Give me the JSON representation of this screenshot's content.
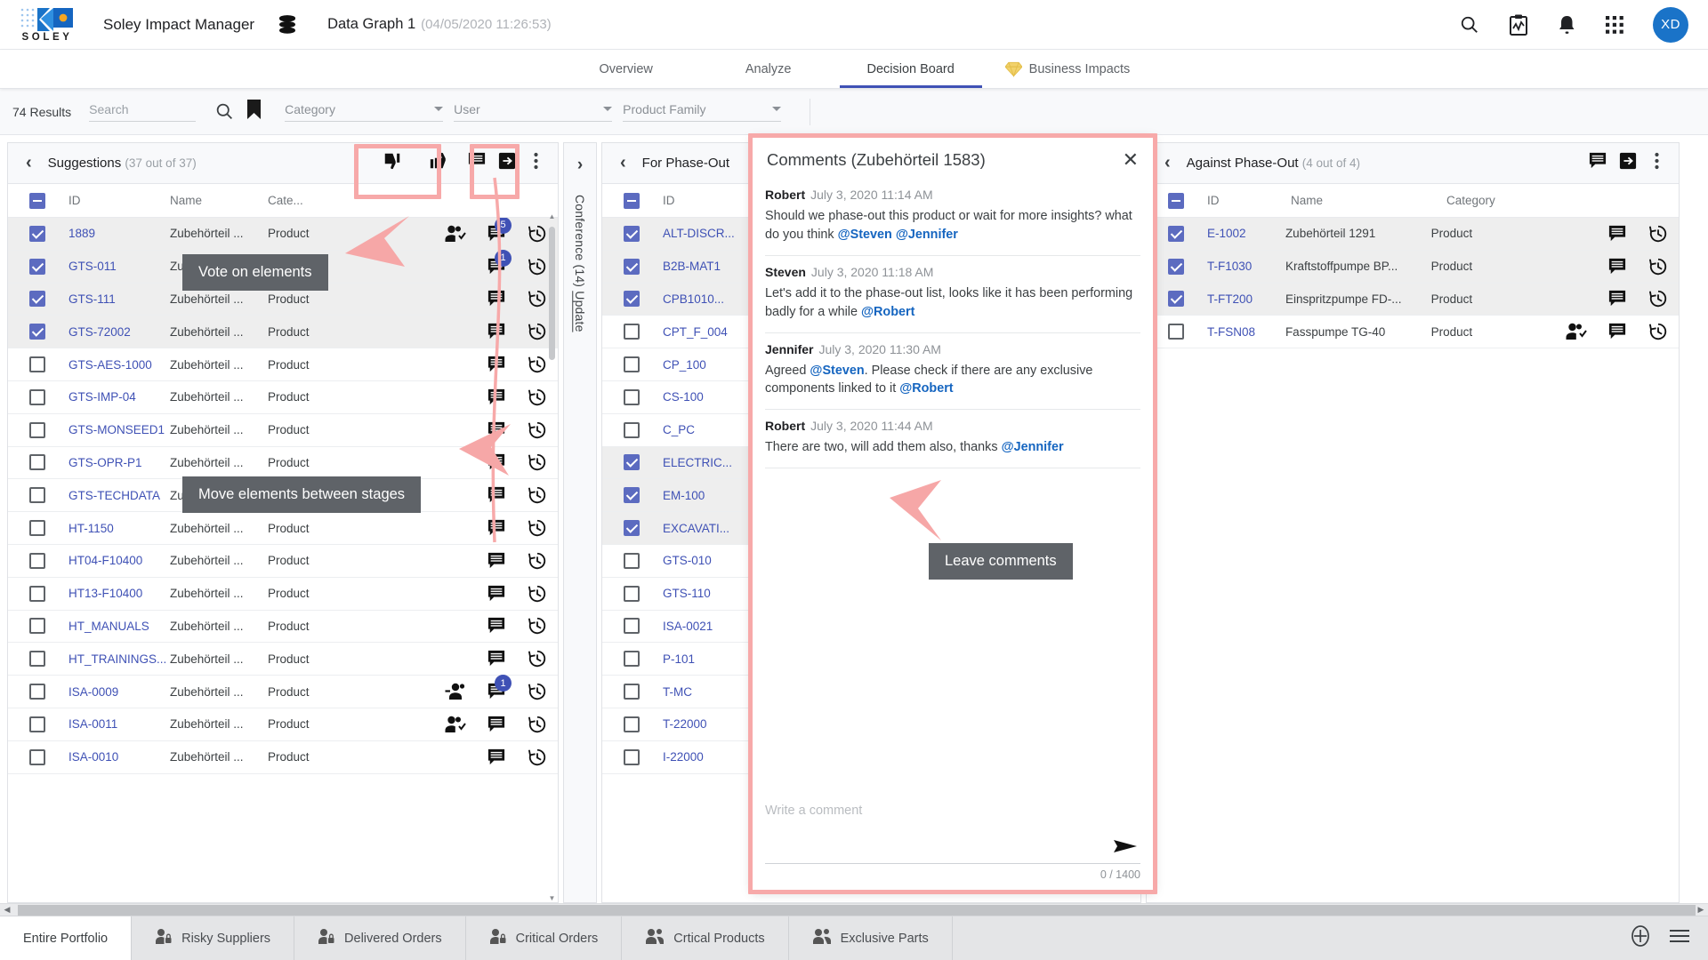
{
  "app": {
    "brand": "SOLEY",
    "title": "Soley Impact Manager",
    "graph_name": "Data Graph 1",
    "graph_date": "(04/05/2020 11:26:53)",
    "avatar_initials": "XD",
    "accent_color": "#3f51b5",
    "highlight_color": "#f7a9a9"
  },
  "topbar_icons": [
    {
      "name": "search-icon"
    },
    {
      "name": "report-icon"
    },
    {
      "name": "notifications-icon"
    },
    {
      "name": "apps-grid-icon"
    }
  ],
  "nav": {
    "tabs": [
      {
        "label": "Overview",
        "active": false,
        "icon": ""
      },
      {
        "label": "Analyze",
        "active": false,
        "icon": ""
      },
      {
        "label": "Decision Board",
        "active": true,
        "icon": ""
      },
      {
        "label": "Business Impacts",
        "active": false,
        "icon": "diamond-icon"
      }
    ]
  },
  "filterbar": {
    "results": "74 Results",
    "search_placeholder": "Search",
    "selects": [
      {
        "label": "Category"
      },
      {
        "label": "User"
      },
      {
        "label": "Product Family"
      }
    ]
  },
  "panels": {
    "suggestions": {
      "title": "Suggestions",
      "count": "(37 out of 37)",
      "columns": [
        "ID",
        "Name",
        "Cate..."
      ],
      "rows": [
        {
          "id": "1889",
          "name": "Zubehörteil ...",
          "cat": "Product",
          "sel": true,
          "users": "users-check-icon",
          "comments": "5"
        },
        {
          "id": "GTS-011",
          "name": "Zubehörteil ...",
          "cat": "Product",
          "sel": true,
          "users": "",
          "comments": "1"
        },
        {
          "id": "GTS-111",
          "name": "Zubehörteil ...",
          "cat": "Product",
          "sel": true,
          "users": "",
          "comments": ""
        },
        {
          "id": "GTS-72002",
          "name": "Zubehörteil ...",
          "cat": "Product",
          "sel": true,
          "users": "",
          "comments": ""
        },
        {
          "id": "GTS-AES-1000",
          "name": "Zubehörteil ...",
          "cat": "Product",
          "sel": false,
          "users": "",
          "comments": ""
        },
        {
          "id": "GTS-IMP-04",
          "name": "Zubehörteil ...",
          "cat": "Product",
          "sel": false,
          "users": "",
          "comments": ""
        },
        {
          "id": "GTS-MONSEED1",
          "name": "Zubehörteil ...",
          "cat": "Product",
          "sel": false,
          "users": "",
          "comments": ""
        },
        {
          "id": "GTS-OPR-P1",
          "name": "Zubehörteil ...",
          "cat": "Product",
          "sel": false,
          "users": "",
          "comments": ""
        },
        {
          "id": "GTS-TECHDATA",
          "name": "Zubehörteil ...",
          "cat": "Product",
          "sel": false,
          "users": "",
          "comments": ""
        },
        {
          "id": "HT-1150",
          "name": "Zubehörteil ...",
          "cat": "Product",
          "sel": false,
          "users": "",
          "comments": ""
        },
        {
          "id": "HT04-F10400",
          "name": "Zubehörteil ...",
          "cat": "Product",
          "sel": false,
          "users": "",
          "comments": ""
        },
        {
          "id": "HT13-F10400",
          "name": "Zubehörteil ...",
          "cat": "Product",
          "sel": false,
          "users": "",
          "comments": ""
        },
        {
          "id": "HT_MANUALS",
          "name": "Zubehörteil ...",
          "cat": "Product",
          "sel": false,
          "users": "",
          "comments": ""
        },
        {
          "id": "HT_TRAININGS...",
          "name": "Zubehörteil ...",
          "cat": "Product",
          "sel": false,
          "users": "",
          "comments": ""
        },
        {
          "id": "ISA-0009",
          "name": "Zubehörteil ...",
          "cat": "Product",
          "sel": false,
          "users": "users-minus-icon",
          "comments": "1"
        },
        {
          "id": "ISA-0011",
          "name": "Zubehörteil ...",
          "cat": "Product",
          "sel": false,
          "users": "users-check-icon",
          "comments": ""
        },
        {
          "id": "ISA-0010",
          "name": "Zubehörteil ...",
          "cat": "Product",
          "sel": false,
          "users": "",
          "comments": ""
        }
      ]
    },
    "conference": {
      "label": "Conference (14)",
      "update_link": "Update"
    },
    "for_phase_out": {
      "title": "For Phase-Out",
      "columns": [
        "ID"
      ],
      "rows": [
        {
          "id": "ALT-DISCR...",
          "sel": true
        },
        {
          "id": "B2B-MAT1",
          "sel": true
        },
        {
          "id": "CPB1010...",
          "sel": true
        },
        {
          "id": "CPT_F_004",
          "sel": false
        },
        {
          "id": "CP_100",
          "sel": false
        },
        {
          "id": "CS-100",
          "sel": false
        },
        {
          "id": "C_PC",
          "sel": false
        },
        {
          "id": "ELECTRIC...",
          "sel": true
        },
        {
          "id": "EM-100",
          "sel": true
        },
        {
          "id": "EXCAVATI...",
          "sel": true
        },
        {
          "id": "GTS-010",
          "sel": false
        },
        {
          "id": "GTS-110",
          "sel": false
        },
        {
          "id": "ISA-0021",
          "sel": false
        },
        {
          "id": "P-101",
          "sel": false
        },
        {
          "id": "T-MC",
          "sel": false
        },
        {
          "id": "T-22000",
          "sel": false
        },
        {
          "id": "I-22000",
          "sel": false
        }
      ]
    },
    "against_phase_out": {
      "title": "Against Phase-Out",
      "count": "(4 out of 4)",
      "columns": [
        "ID",
        "Name",
        "Category"
      ],
      "rows": [
        {
          "id": "E-1002",
          "name": "Zubehörteil 1291",
          "cat": "Product",
          "sel": true,
          "users": ""
        },
        {
          "id": "T-F1030",
          "name": "Kraftstoffpumpe BP...",
          "cat": "Product",
          "sel": true,
          "users": ""
        },
        {
          "id": "T-FT200",
          "name": "Einspritzpumpe FD-...",
          "cat": "Product",
          "sel": true,
          "users": ""
        },
        {
          "id": "T-FSN08",
          "name": "Fasspumpe TG-40",
          "cat": "Product",
          "sel": false,
          "users": "users-check-icon"
        }
      ]
    }
  },
  "comments": {
    "title": "Comments (Zubehörteil 1583)",
    "items": [
      {
        "author": "Robert",
        "time": "July 3, 2020 11:14 AM",
        "parts": [
          {
            "t": "Should we phase-out this product or wait for more insights? what do you think ",
            "m": false
          },
          {
            "t": "@Steven",
            "m": true
          },
          {
            "t": " ",
            "m": false
          },
          {
            "t": "@Jennifer",
            "m": true
          }
        ]
      },
      {
        "author": "Steven",
        "time": "July 3, 2020 11:18 AM",
        "parts": [
          {
            "t": "Let's add it to the phase-out list, looks like it has been performing badly for a while ",
            "m": false
          },
          {
            "t": "@Robert",
            "m": true
          }
        ]
      },
      {
        "author": "Jennifer",
        "time": "July 3, 2020 11:30 AM",
        "parts": [
          {
            "t": "Agreed ",
            "m": false
          },
          {
            "t": "@Steven",
            "m": true
          },
          {
            "t": ". Please check if there are any exclusive components linked to it ",
            "m": false
          },
          {
            "t": "@Robert",
            "m": true
          }
        ]
      },
      {
        "author": "Robert",
        "time": "July 3, 2020 11:44 AM",
        "parts": [
          {
            "t": "There are two, will add them also, thanks ",
            "m": false
          },
          {
            "t": "@Jennifer",
            "m": true
          }
        ]
      }
    ],
    "compose_placeholder": "Write a comment",
    "counter": "0 / 1400"
  },
  "annotations": [
    {
      "text": "Vote on elements"
    },
    {
      "text": "Move elements between stages"
    },
    {
      "text": "Leave comments"
    }
  ],
  "bottom": {
    "tabs": [
      {
        "label": "Entire Portfolio",
        "active": true,
        "icon": ""
      },
      {
        "label": "Risky Suppliers",
        "active": false,
        "icon": "user-lock-icon"
      },
      {
        "label": "Delivered Orders",
        "active": false,
        "icon": "user-lock-icon"
      },
      {
        "label": "Critical Orders",
        "active": false,
        "icon": "user-lock-icon"
      },
      {
        "label": "Crtical Products",
        "active": false,
        "icon": "users-icon"
      },
      {
        "label": "Exclusive Parts",
        "active": false,
        "icon": "users-icon"
      }
    ],
    "actions": [
      {
        "name": "add-tab-icon"
      },
      {
        "name": "menu-icon"
      }
    ]
  }
}
